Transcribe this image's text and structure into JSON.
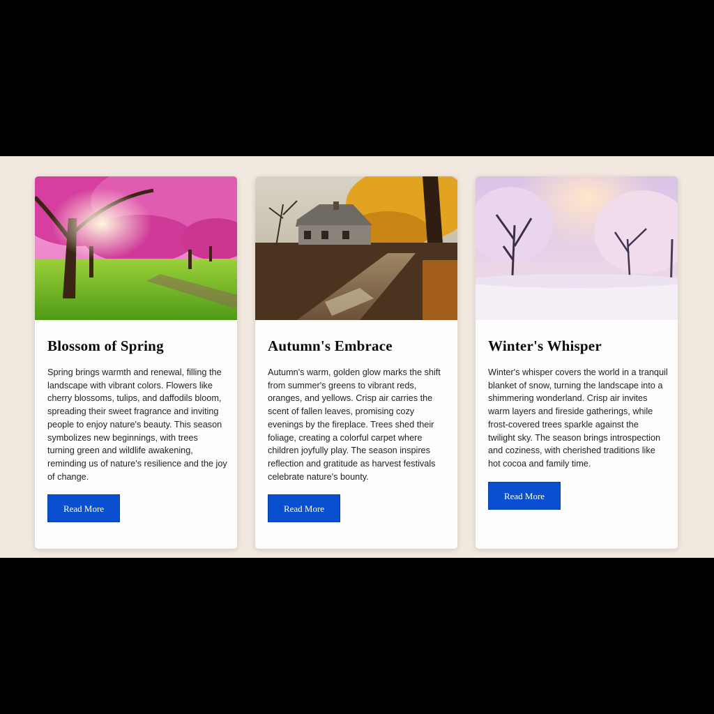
{
  "cards": [
    {
      "title": "Blossom of Spring",
      "description": "Spring brings warmth and renewal, filling the landscape with vibrant colors. Flowers like cherry blossoms, tulips, and daffodils bloom, spreading their sweet fragrance and inviting people to enjoy nature's beauty. This season symbolizes new beginnings, with trees turning green and wildlife awakening, reminding us of nature's resilience and the joy of change.",
      "button_label": "Read More",
      "image_subject": "cherry-blossom-park"
    },
    {
      "title": "Autumn's Embrace",
      "description": "Autumn's warm, golden glow marks the shift from summer's greens to vibrant reds, oranges, and yellows. Crisp air carries the scent of fallen leaves, promising cozy evenings by the fireplace. Trees shed their foliage, creating a colorful carpet where children joyfully play. The season inspires reflection and gratitude as harvest festivals celebrate nature's bounty.",
      "button_label": "Read More",
      "image_subject": "farmhouse-autumn-road"
    },
    {
      "title": "Winter's Whisper",
      "description": "Winter's whisper covers the world in a tranquil blanket of snow, turning the landscape into a shimmering wonderland. Crisp air invites warm layers and fireside gatherings, while frost-covered trees sparkle against the twilight sky. The season brings introspection and coziness, with cherished traditions like hot cocoa and family time.",
      "button_label": "Read More",
      "image_subject": "snowy-forest-twilight"
    }
  ],
  "colors": {
    "band_background": "#f1e9df",
    "card_background": "#fdfdfd",
    "button_background": "#0a4fcf",
    "letterbox": "#000000"
  }
}
